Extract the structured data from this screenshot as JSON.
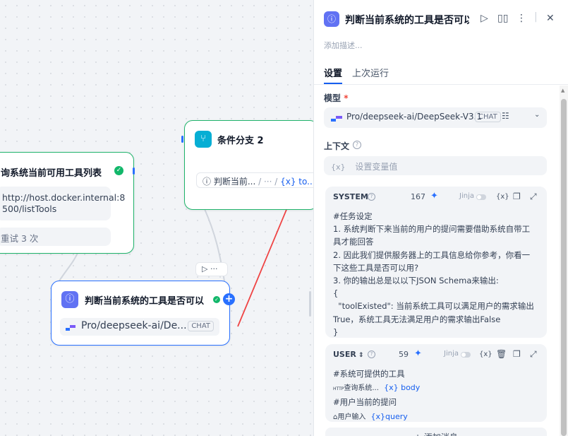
{
  "canvas": {
    "query_node": {
      "title": "询系统当前可用工具列表",
      "url_line1": "http://host.docker.internal:8",
      "url_line2": "500/listTools",
      "retry": "重试 3 次"
    },
    "condition_node": {
      "title": "条件分支 2",
      "condition_left": "判断当前...",
      "condition_sep": "/ ··· /",
      "condition_var": "{x} to..."
    },
    "judge_node": {
      "title": "判断当前系统的工具是否可以",
      "model": "Pro/deepseek-ai/De...",
      "badge": "CHAT"
    },
    "mini_toolbar": "▷ ···"
  },
  "panel": {
    "title": "判断当前系统的工具是否可以",
    "description_placeholder": "添加描述...",
    "tabs": [
      {
        "label": "设置"
      },
      {
        "label": "上次运行"
      }
    ],
    "model_label": "模型",
    "model_required": "*",
    "model_value": "Pro/deepseek-ai/DeepSeek-V3.1",
    "model_badge": "CHAT",
    "context_label": "上下文",
    "context_placeholder": "设置变量值",
    "context_var_icon": "{x}",
    "system": {
      "role": "SYSTEM",
      "tokens": "167",
      "jinja": "Jinja",
      "lines": [
        "#任务设定",
        "1. 系统判断下来当前的用户的提问需要借助系统自带工",
        "具才能回答",
        "2. 因此我们提供服务器上的工具信息给你参考，你看一",
        "下这些工具是否可以用?",
        "3. 你的输出总是以以下JSON Schema来输出:",
        "{",
        "  \"toolExisted\": 当前系统工具可以满足用户的需求输出",
        "True，系统工具无法满足用户的需求输出False",
        "}"
      ]
    },
    "user": {
      "role": "USER",
      "tokens": "59",
      "jinja": "Jinja",
      "line1": "#系统可提供的工具",
      "var1_node": "查询系统...",
      "var1_name": "{x} body",
      "line2": "#用户当前的提问",
      "var2_node": "用户输入",
      "var2_name": "{x}query"
    },
    "add_message": "+ 添加消息"
  },
  "colors": {
    "accent": "#2970ff",
    "success": "#12b76a",
    "llm_icon": "#6172f3",
    "condition_icon": "#06aed4",
    "annotation_arrow": "#ef4444"
  }
}
